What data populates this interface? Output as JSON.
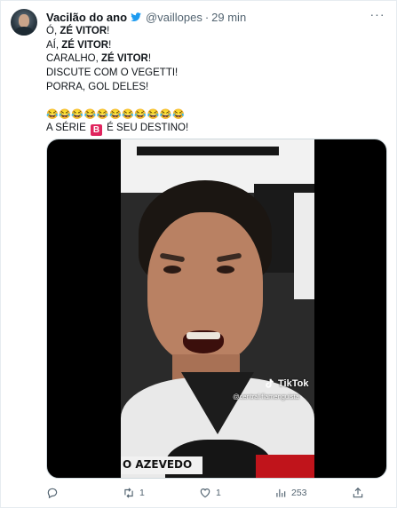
{
  "tweet": {
    "author_name": "Vacilão do ano",
    "handle": "@vaillopes",
    "separator": "·",
    "time": "29 min",
    "lines": [
      {
        "prefix": "Ó, ",
        "bold": "ZÉ VITOR",
        "suffix": "!"
      },
      {
        "prefix": "AÍ, ",
        "bold": "ZÉ VITOR",
        "suffix": "!"
      },
      {
        "prefix": "CARALHO, ",
        "bold": "ZÉ VITOR",
        "suffix": "!"
      },
      {
        "text": "DISCUTE COM O VEGETTI!"
      },
      {
        "text": "PORRA, GOL DELES!"
      }
    ],
    "emoji_line": "😂😂😂😂😂😂😂😂😂😂😂",
    "destiny": {
      "prefix": "A SÉRIE",
      "badge": "B",
      "suffix": "É SEU DESTINO!"
    }
  },
  "media": {
    "tiktok_label": "TikTok",
    "tiktok_handle": "@central.flamenguista",
    "lower_third": "O AZEVEDO"
  },
  "actions": {
    "reply_count": "",
    "retweet_count": "1",
    "like_count": "1",
    "views_count": "253"
  },
  "icons": [
    "verified-bird-icon",
    "more-icon",
    "reply-icon",
    "retweet-icon",
    "like-icon",
    "views-icon",
    "share-icon",
    "tiktok-icon"
  ],
  "colors": {
    "text": "#0f1419",
    "secondary": "#536471",
    "badge": "#e0245e"
  }
}
